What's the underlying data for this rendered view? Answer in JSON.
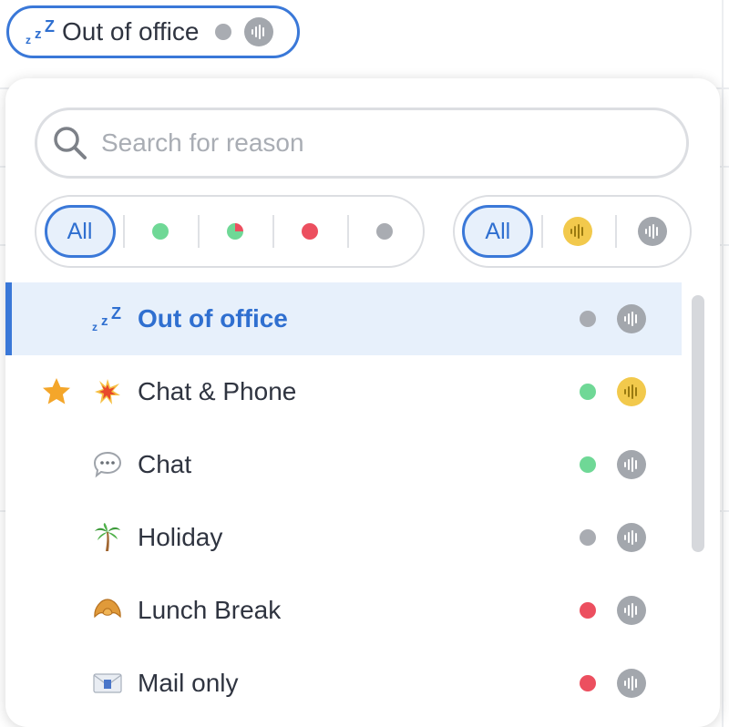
{
  "trigger": {
    "label": "Out of office",
    "zzz": [
      "z",
      "z",
      "Z"
    ]
  },
  "search": {
    "placeholder": "Search for reason",
    "value": ""
  },
  "filters": {
    "availability": {
      "all_label": "All",
      "options": [
        "green",
        "split",
        "red",
        "gray"
      ]
    },
    "voice": {
      "all_label": "All",
      "options": [
        "yellow-voice",
        "gray-voice"
      ]
    }
  },
  "reasons": [
    {
      "label": "Out of office",
      "icon": "zzz-icon",
      "status": "gray",
      "voice": "gray",
      "selected": true,
      "favorite": false
    },
    {
      "label": "Chat & Phone",
      "icon": "collision-icon",
      "status": "green",
      "voice": "yellow",
      "selected": false,
      "favorite": true
    },
    {
      "label": "Chat",
      "icon": "speech-bubble-icon",
      "status": "green",
      "voice": "gray",
      "selected": false,
      "favorite": false
    },
    {
      "label": "Holiday",
      "icon": "palm-tree-icon",
      "status": "gray",
      "voice": "gray",
      "selected": false,
      "favorite": false
    },
    {
      "label": "Lunch Break",
      "icon": "croissant-icon",
      "status": "red",
      "voice": "gray",
      "selected": false,
      "favorite": false
    },
    {
      "label": "Mail only",
      "icon": "envelope-icon",
      "status": "red",
      "voice": "gray",
      "selected": false,
      "favorite": false
    }
  ],
  "colors": {
    "accent": "#3a78d8",
    "selected_bg": "#e7f0fb",
    "green": "#6fd896",
    "red": "#ec4f5f",
    "gray": "#a9acb2",
    "yellow": "#f2c94c"
  }
}
